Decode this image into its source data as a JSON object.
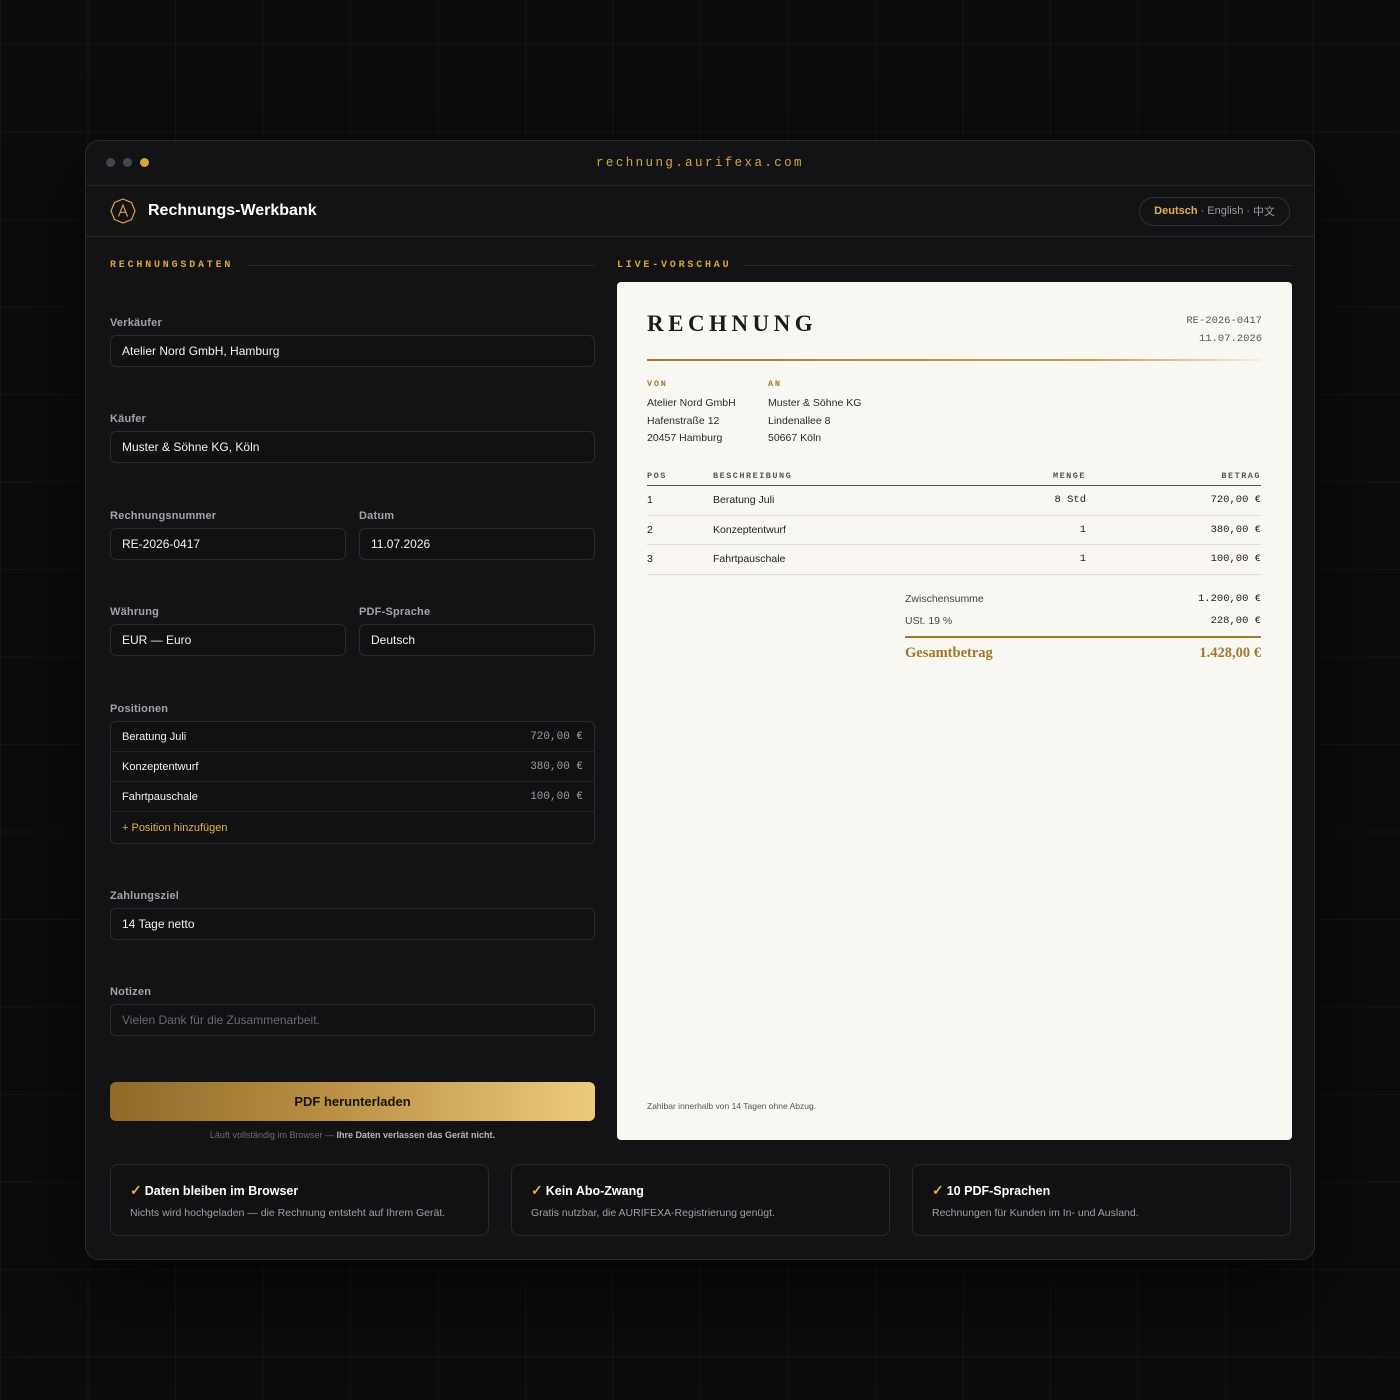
{
  "browser": {
    "url": "rechnung.aurifexa.com"
  },
  "app": {
    "title": "Rechnungs-Werkbank",
    "languages": [
      "Deutsch",
      "English",
      "中文"
    ],
    "active_language": "Deutsch"
  },
  "form": {
    "section_title": "RECHNUNGSDATEN",
    "seller": {
      "label": "Verkäufer",
      "value": "Atelier Nord GmbH, Hamburg"
    },
    "buyer": {
      "label": "Käufer",
      "value": "Muster & Söhne KG, Köln"
    },
    "invoice_number": {
      "label": "Rechnungsnummer",
      "value": "RE-2026-0417"
    },
    "date": {
      "label": "Datum",
      "value": "11.07.2026"
    },
    "currency": {
      "label": "Währung",
      "value": "EUR — Euro"
    },
    "pdf_language": {
      "label": "PDF-Sprache",
      "value": "Deutsch"
    },
    "positions": {
      "label": "Positionen",
      "items": [
        {
          "name": "Beratung Juli",
          "amount": "720,00 €"
        },
        {
          "name": "Konzeptentwurf",
          "amount": "380,00 €"
        },
        {
          "name": "Fahrtpauschale",
          "amount": "100,00 €"
        }
      ],
      "add_label": "+ Position hinzufügen"
    },
    "payment_terms": {
      "label": "Zahlungsziel",
      "value": "14 Tage netto"
    },
    "notes": {
      "label": "Notizen",
      "placeholder": "Vielen Dank für die Zusammenarbeit."
    },
    "download_label": "PDF herunterladen",
    "privacy_text": "Läuft vollständig im Browser — ",
    "privacy_strong": "Ihre Daten verlassen das Gerät nicht."
  },
  "preview": {
    "section_title": "LIVE-VORSCHAU",
    "title": "RECHNUNG",
    "number": "RE-2026-0417",
    "date": "11.07.2026",
    "from": {
      "heading": "VON",
      "lines": [
        "Atelier Nord GmbH",
        "Hafenstraße 12",
        "20457 Hamburg"
      ]
    },
    "to": {
      "heading": "AN",
      "lines": [
        "Muster & Söhne KG",
        "Lindenallee 8",
        "50667 Köln"
      ]
    },
    "table": {
      "headers": {
        "pos": "POS",
        "desc": "BESCHREIBUNG",
        "qty": "MENGE",
        "amount": "BETRAG"
      },
      "rows": [
        {
          "pos": "1",
          "desc": "Beratung Juli",
          "qty": "8 Std",
          "amount": "720,00 €"
        },
        {
          "pos": "2",
          "desc": "Konzeptentwurf",
          "qty": "1",
          "amount": "380,00 €"
        },
        {
          "pos": "3",
          "desc": "Fahrtpauschale",
          "qty": "1",
          "amount": "100,00 €"
        }
      ]
    },
    "subtotal": {
      "label": "Zwischensumme",
      "value": "1.200,00 €"
    },
    "vat": {
      "label": "USt. 19 %",
      "value": "228,00 €"
    },
    "total": {
      "label": "Gesamtbetrag",
      "value": "1.428,00 €"
    },
    "footer": "Zahlbar innerhalb von 14 Tagen ohne Abzug."
  },
  "features": [
    {
      "title": "Daten bleiben im Browser",
      "desc": "Nichts wird hochgeladen — die Rechnung entsteht auf Ihrem Gerät."
    },
    {
      "title": "Kein Abo-Zwang",
      "desc": "Gratis nutzbar, die AURIFEXA-Registrierung genügt."
    },
    {
      "title": "10 PDF-Sprachen",
      "desc": "Rechnungen für Kunden im In- und Ausland."
    }
  ],
  "colors": {
    "accent": "#d9a441",
    "gold_dark": "#a0782e",
    "background": "#0c0c0d",
    "paper": "#f9f7f1"
  }
}
